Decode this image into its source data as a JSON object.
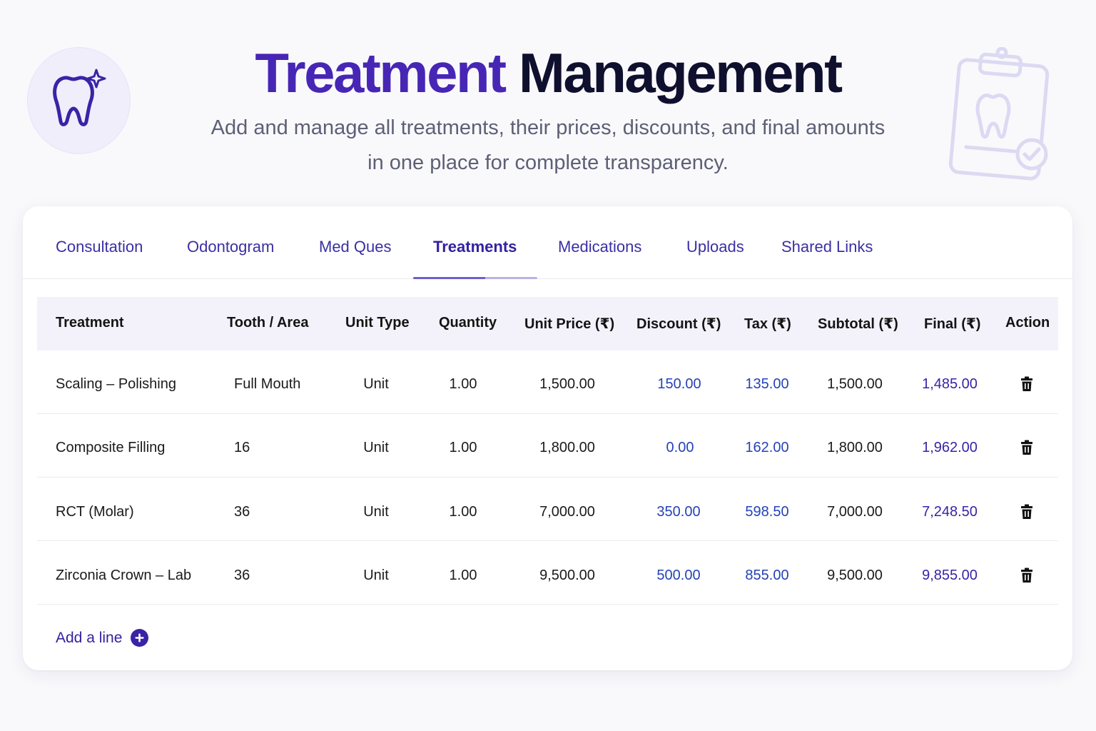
{
  "header": {
    "title_part1": "Treatment",
    "title_part2": "Management",
    "subtitle_line1": "Add and manage all treatments, their prices, discounts, and final amounts",
    "subtitle_line2": "in one place for complete transparency."
  },
  "icons": {
    "logo": "tooth-sparkle-icon",
    "illustration": "clipboard-tooth-check-icon",
    "delete": "trash-icon",
    "add": "plus-circle-icon"
  },
  "tabs": [
    {
      "label": "Consultation"
    },
    {
      "label": "Odontogram"
    },
    {
      "label": "Med Ques"
    },
    {
      "label": "Treatments"
    },
    {
      "label": "Medications"
    },
    {
      "label": "Uploads"
    },
    {
      "label": "Shared Links"
    }
  ],
  "active_tab": "Treatments",
  "table": {
    "headers": [
      "Treatment",
      "Tooth / Area",
      "Unit Type",
      "Quantity",
      "Unit Price (₹)",
      "Discount (₹)",
      "Tax (₹)",
      "Subtotal (₹)",
      "Final (₹)",
      "Action"
    ],
    "rows": [
      {
        "treatment": "Scaling – Polishing",
        "tooth": "Full Mouth",
        "unit_type": "Unit",
        "quantity": "1.00",
        "unit_price": "1,500.00",
        "discount": "150.00",
        "tax": "135.00",
        "subtotal": "1,500.00",
        "final": "1,485.00"
      },
      {
        "treatment": "Composite Filling",
        "tooth": "16",
        "unit_type": "Unit",
        "quantity": "1.00",
        "unit_price": "1,800.00",
        "discount": "0.00",
        "tax": "162.00",
        "subtotal": "1,800.00",
        "final": "1,962.00"
      },
      {
        "treatment": "RCT (Molar)",
        "tooth": "36",
        "unit_type": "Unit",
        "quantity": "1.00",
        "unit_price": "7,000.00",
        "discount": "350.00",
        "tax": "598.50",
        "subtotal": "7,000.00",
        "final": "7,248.50"
      },
      {
        "treatment": "Zirconia Crown – Lab",
        "tooth": "36",
        "unit_type": "Unit",
        "quantity": "1.00",
        "unit_price": "9,500.00",
        "discount": "500.00",
        "tax": "855.00",
        "subtotal": "9,500.00",
        "final": "9,855.00"
      }
    ]
  },
  "add_line_label": "Add a line",
  "colors": {
    "brand_purple": "#4726b5",
    "title_dark": "#0f0f2e",
    "discount_tax_blue": "#2442b8",
    "final_purple": "#3a23a6"
  }
}
